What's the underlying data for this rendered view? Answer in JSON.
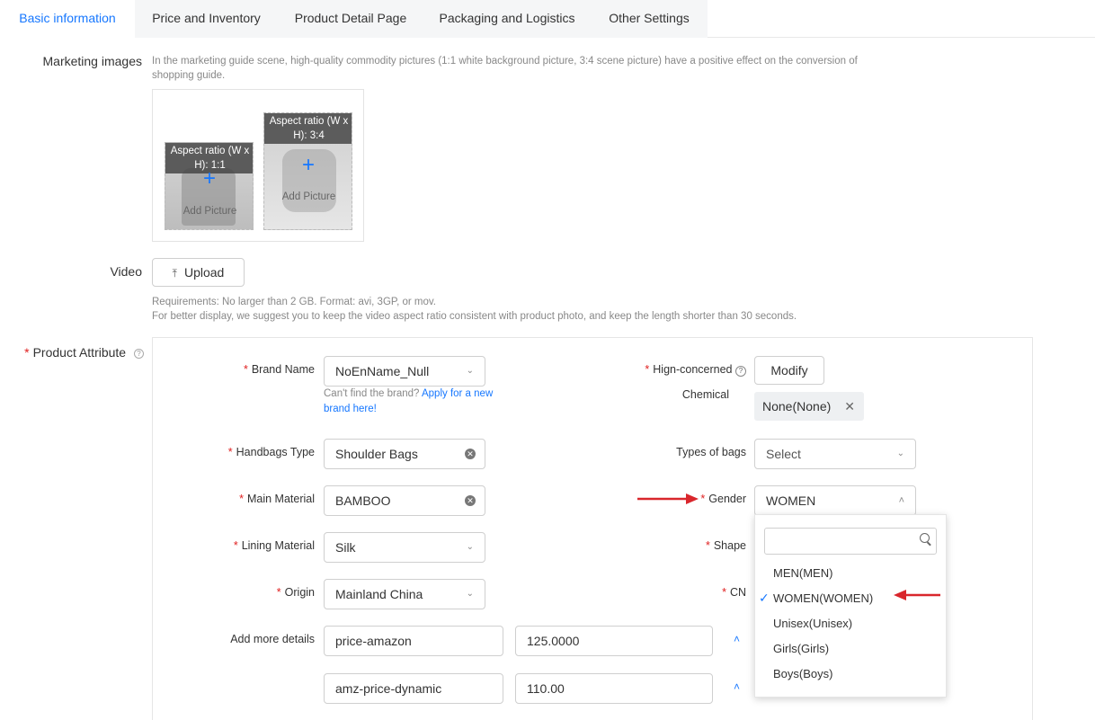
{
  "tabs": [
    {
      "label": "Basic information",
      "active": true
    },
    {
      "label": "Price and Inventory",
      "active": false
    },
    {
      "label": "Product Detail Page",
      "active": false
    },
    {
      "label": "Packaging and Logistics",
      "active": false
    },
    {
      "label": "Other Settings",
      "active": false
    }
  ],
  "marketing": {
    "label": "Marketing images",
    "hint": "In the marketing guide scene, high-quality commodity pictures (1:1 white background picture, 3:4 scene picture) have a positive effect on the conversion of shopping guide.",
    "slot1": {
      "ratio": "Aspect ratio (W x H): 1:1",
      "add": "Add Picture"
    },
    "slot2": {
      "ratio": "Aspect ratio (W x H): 3:4",
      "add": "Add Picture"
    }
  },
  "video": {
    "label": "Video",
    "upload": "Upload",
    "req_line1": "Requirements: No larger than 2 GB. Format: avi, 3GP, or mov.",
    "req_line2": "For better display, we suggest you to keep the video aspect ratio consistent with product photo, and keep the length shorter than 30 seconds."
  },
  "attr": {
    "label": "Product Attribute",
    "brand": {
      "label": "Brand Name",
      "value": "NoEnName_Null",
      "hint_prefix": "Can't find the brand?",
      "hint_link": "Apply for a new brand here!"
    },
    "chem": {
      "label": "Hign-concerned",
      "label2": "Chemical",
      "modify": "Modify",
      "tag": "None(None)"
    },
    "handbags": {
      "label": "Handbags Type",
      "value": "Shoulder Bags"
    },
    "bagtypes": {
      "label": "Types of bags",
      "placeholder": "Select"
    },
    "material": {
      "label": "Main Material",
      "value": "BAMBOO"
    },
    "gender": {
      "label": "Gender",
      "value": "WOMEN"
    },
    "lining": {
      "label": "Lining Material",
      "value": "Silk"
    },
    "shape": {
      "label": "Shape"
    },
    "origin": {
      "label": "Origin",
      "value": "Mainland China"
    },
    "cn": {
      "label": "CN"
    },
    "more": {
      "label": "Add more details"
    },
    "row1": {
      "key": "price-amazon",
      "val": "125.0000"
    },
    "row2": {
      "key": "amz-price-dynamic",
      "val": "110.00"
    }
  },
  "dropdown": {
    "search_placeholder": "",
    "options": [
      "MEN(MEN)",
      "WOMEN(WOMEN)",
      "Unisex(Unisex)",
      "Girls(Girls)",
      "Boys(Boys)"
    ],
    "selected": "WOMEN(WOMEN)"
  },
  "colors": {
    "accent": "#1677ff",
    "required": "#e02020",
    "arrow": "#d9262c"
  }
}
